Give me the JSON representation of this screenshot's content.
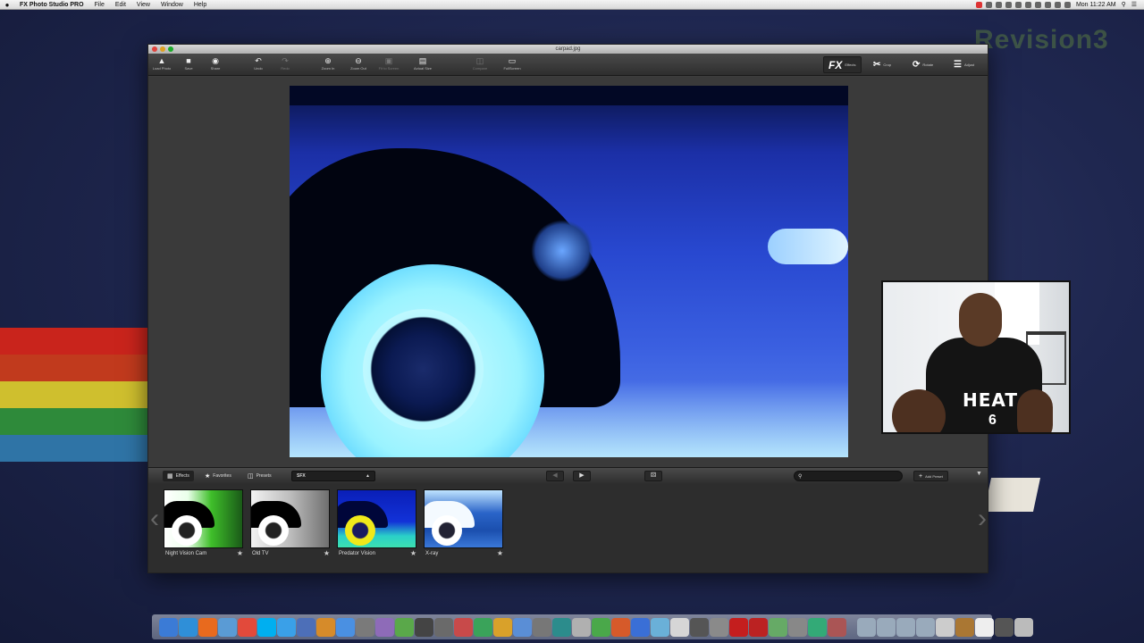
{
  "menubar": {
    "app_name": "FX Photo Studio PRO",
    "menus": [
      "File",
      "Edit",
      "View",
      "Window",
      "Help"
    ],
    "clock": "Mon 11:22 AM"
  },
  "desktop": {
    "watermark": "Revision3"
  },
  "window": {
    "title": "carpad.jpg",
    "toolbar": {
      "load_photo": "Load Photo",
      "save": "Save",
      "share": "Share",
      "undo": "Undo",
      "redo": "Redo",
      "zoom_in": "Zoom In",
      "zoom_out": "Zoom Out",
      "fit_to_screen": "Fit to Screen",
      "actual_size": "Actual Size",
      "compare": "Compare",
      "fullscreen": "FullScreen",
      "effects_logo": "FX",
      "effects": "Effects",
      "crop": "Crop",
      "rotate": "Rotate",
      "adjust": "Adjust"
    },
    "panel": {
      "tabs": [
        "Effects",
        "Favorites",
        "Presets"
      ],
      "category": "SFX",
      "search_placeholder": "",
      "add_preset": "Add Preset"
    },
    "thumbnails": [
      {
        "name": "Night Vision Cam"
      },
      {
        "name": "Old TV"
      },
      {
        "name": "Predator Vision"
      },
      {
        "name": "X-ray"
      }
    ]
  },
  "webcam": {
    "jersey_text": "HEAT",
    "jersey_number": "6"
  },
  "dock": {
    "icons": [
      "finder-icon",
      "safari-icon",
      "firefox-icon",
      "mail-icon",
      "chrome-icon",
      "skype-icon",
      "twitter-icon",
      "xcode-icon",
      "photos-icon",
      "itunes-icon",
      "app-icon",
      "app-icon",
      "app-icon",
      "stream-icon",
      "app-icon",
      "app-icon",
      "app-icon",
      "app-icon",
      "app-icon",
      "app-icon",
      "app-icon",
      "app-icon",
      "app-icon",
      "app-icon",
      "app-icon",
      "app-icon",
      "app-icon",
      "app-icon",
      "app-icon",
      "filezilla-icon",
      "app-icon",
      "app-icon",
      "app-icon",
      "app-icon",
      "app-icon",
      "folder-icon",
      "folder-icon",
      "folder-icon",
      "folder-icon",
      "app-icon",
      "app-icon",
      "app-icon",
      "app-icon",
      "trash-icon"
    ]
  }
}
